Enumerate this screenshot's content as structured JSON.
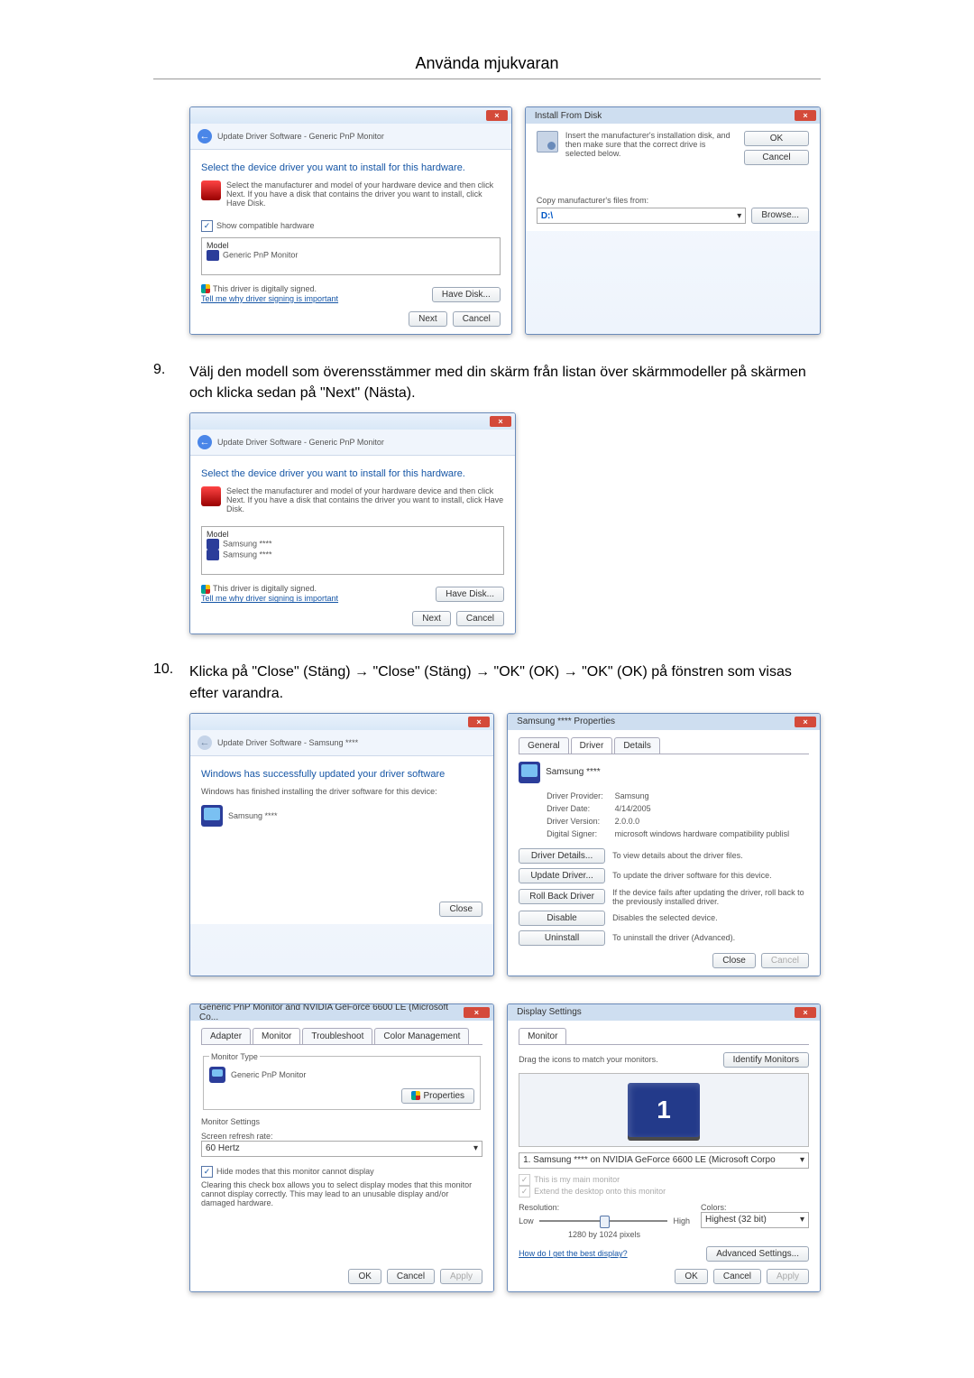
{
  "page_title": "Använda mjukvaran",
  "step9": {
    "num": "9.",
    "text": "Välj den modell som överensstämmer med din skärm från listan över skärmmodeller på skärmen och klicka sedan på \"Next\" (Nästa)."
  },
  "step10": {
    "num": "10.",
    "text": "Klicka på \"Close\" (Stäng) → \"Close\" (Stäng) → \"OK\" (OK) → \"OK\" (OK) på fönstren som visas efter varandra."
  },
  "dlg_select1": {
    "breadcrumb": "Update Driver Software - Generic PnP Monitor",
    "heading": "Select the device driver you want to install for this hardware.",
    "desc": "Select the manufacturer and model of your hardware device and then click Next. If you have a disk that contains the driver you want to install, click Have Disk.",
    "show_compat": "Show compatible hardware",
    "model_label": "Model",
    "model_item": "Generic PnP Monitor",
    "signed": "This driver is digitally signed.",
    "tell_me": "Tell me why driver signing is important",
    "have_disk": "Have Disk...",
    "next": "Next",
    "cancel": "Cancel"
  },
  "dlg_install_from_disk": {
    "title": "Install From Disk",
    "desc": "Insert the manufacturer's installation disk, and then make sure that the correct drive is selected below.",
    "ok": "OK",
    "cancel": "Cancel",
    "copy_label": "Copy manufacturer's files from:",
    "path": "D:\\",
    "browse": "Browse..."
  },
  "dlg_select2": {
    "breadcrumb": "Update Driver Software - Generic PnP Monitor",
    "heading": "Select the device driver you want to install for this hardware.",
    "desc": "Select the manufacturer and model of your hardware device and then click Next. If you have a disk that contains the driver you want to install, click Have Disk.",
    "model_label": "Model",
    "model_items": [
      "Samsung ****",
      "Samsung ****"
    ],
    "signed": "This driver is digitally signed.",
    "tell_me": "Tell me why driver signing is important",
    "have_disk": "Have Disk...",
    "next": "Next",
    "cancel": "Cancel"
  },
  "dlg_success": {
    "breadcrumb": "Update Driver Software - Samsung ****",
    "heading": "Windows has successfully updated your driver software",
    "desc": "Windows has finished installing the driver software for this device:",
    "device": "Samsung ****",
    "close": "Close"
  },
  "dlg_props": {
    "title": "Samsung **** Properties",
    "tabs": [
      "General",
      "Driver",
      "Details"
    ],
    "device": "Samsung ****",
    "rows": {
      "provider_label": "Driver Provider:",
      "provider_val": "Samsung",
      "date_label": "Driver Date:",
      "date_val": "4/14/2005",
      "version_label": "Driver Version:",
      "version_val": "2.0.0.0",
      "signer_label": "Digital Signer:",
      "signer_val": "microsoft windows hardware compatibility publisl"
    },
    "btns": {
      "details": "Driver Details...",
      "details_desc": "To view details about the driver files.",
      "update": "Update Driver...",
      "update_desc": "To update the driver software for this device.",
      "rollback": "Roll Back Driver",
      "rollback_desc": "If the device fails after updating the driver, roll back to the previously installed driver.",
      "disable": "Disable",
      "disable_desc": "Disables the selected device.",
      "uninstall": "Uninstall",
      "uninstall_desc": "To uninstall the driver (Advanced)."
    },
    "close": "Close",
    "cancel": "Cancel"
  },
  "dlg_monitor": {
    "title": "Generic PnP Monitor and NVIDIA GeForce 6600 LE (Microsoft Co...",
    "tabs": [
      "Adapter",
      "Monitor",
      "Troubleshoot",
      "Color Management"
    ],
    "monitor_type_label": "Monitor Type",
    "monitor_type_val": "Generic PnP Monitor",
    "properties": "Properties",
    "monitor_settings_label": "Monitor Settings",
    "refresh_label": "Screen refresh rate:",
    "refresh_val": "60 Hertz",
    "hide_modes": "Hide modes that this monitor cannot display",
    "hide_desc": "Clearing this check box allows you to select display modes that this monitor cannot display correctly. This may lead to an unusable display and/or damaged hardware.",
    "ok": "OK",
    "cancel": "Cancel",
    "apply": "Apply"
  },
  "dlg_display": {
    "title": "Display Settings",
    "tab": "Monitor",
    "drag_text": "Drag the icons to match your monitors.",
    "identify": "Identify Monitors",
    "monitor_num": "1",
    "monitor_select": "1. Samsung **** on NVIDIA GeForce 6600 LE (Microsoft Corpo",
    "main_check": "This is my main monitor",
    "extend_check": "Extend the desktop onto this monitor",
    "res_label": "Resolution:",
    "low": "Low",
    "high": "High",
    "res_val": "1280 by 1024 pixels",
    "colors_label": "Colors:",
    "colors_val": "Highest (32 bit)",
    "best_display": "How do I get the best display?",
    "advanced": "Advanced Settings...",
    "ok": "OK",
    "cancel": "Cancel",
    "apply": "Apply"
  }
}
